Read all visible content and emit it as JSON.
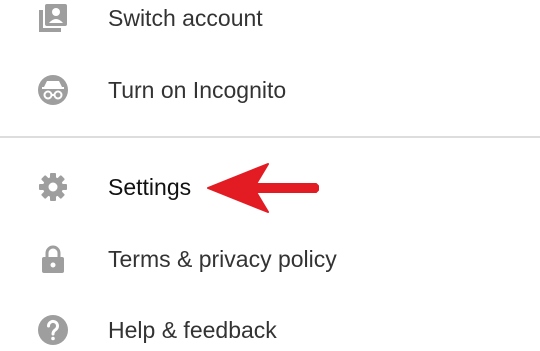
{
  "menu": {
    "items": [
      {
        "label": "Switch account",
        "icon": "switch-account-icon"
      },
      {
        "label": "Turn on Incognito",
        "icon": "incognito-icon"
      },
      {
        "label": "Settings",
        "icon": "gear-icon"
      },
      {
        "label": "Terms & privacy policy",
        "icon": "lock-icon"
      },
      {
        "label": "Help & feedback",
        "icon": "help-icon"
      }
    ]
  },
  "colors": {
    "icon": "#9e9e9e",
    "text": "#333333",
    "divider": "#dddddd",
    "annotation_arrow": "#e31b23"
  }
}
